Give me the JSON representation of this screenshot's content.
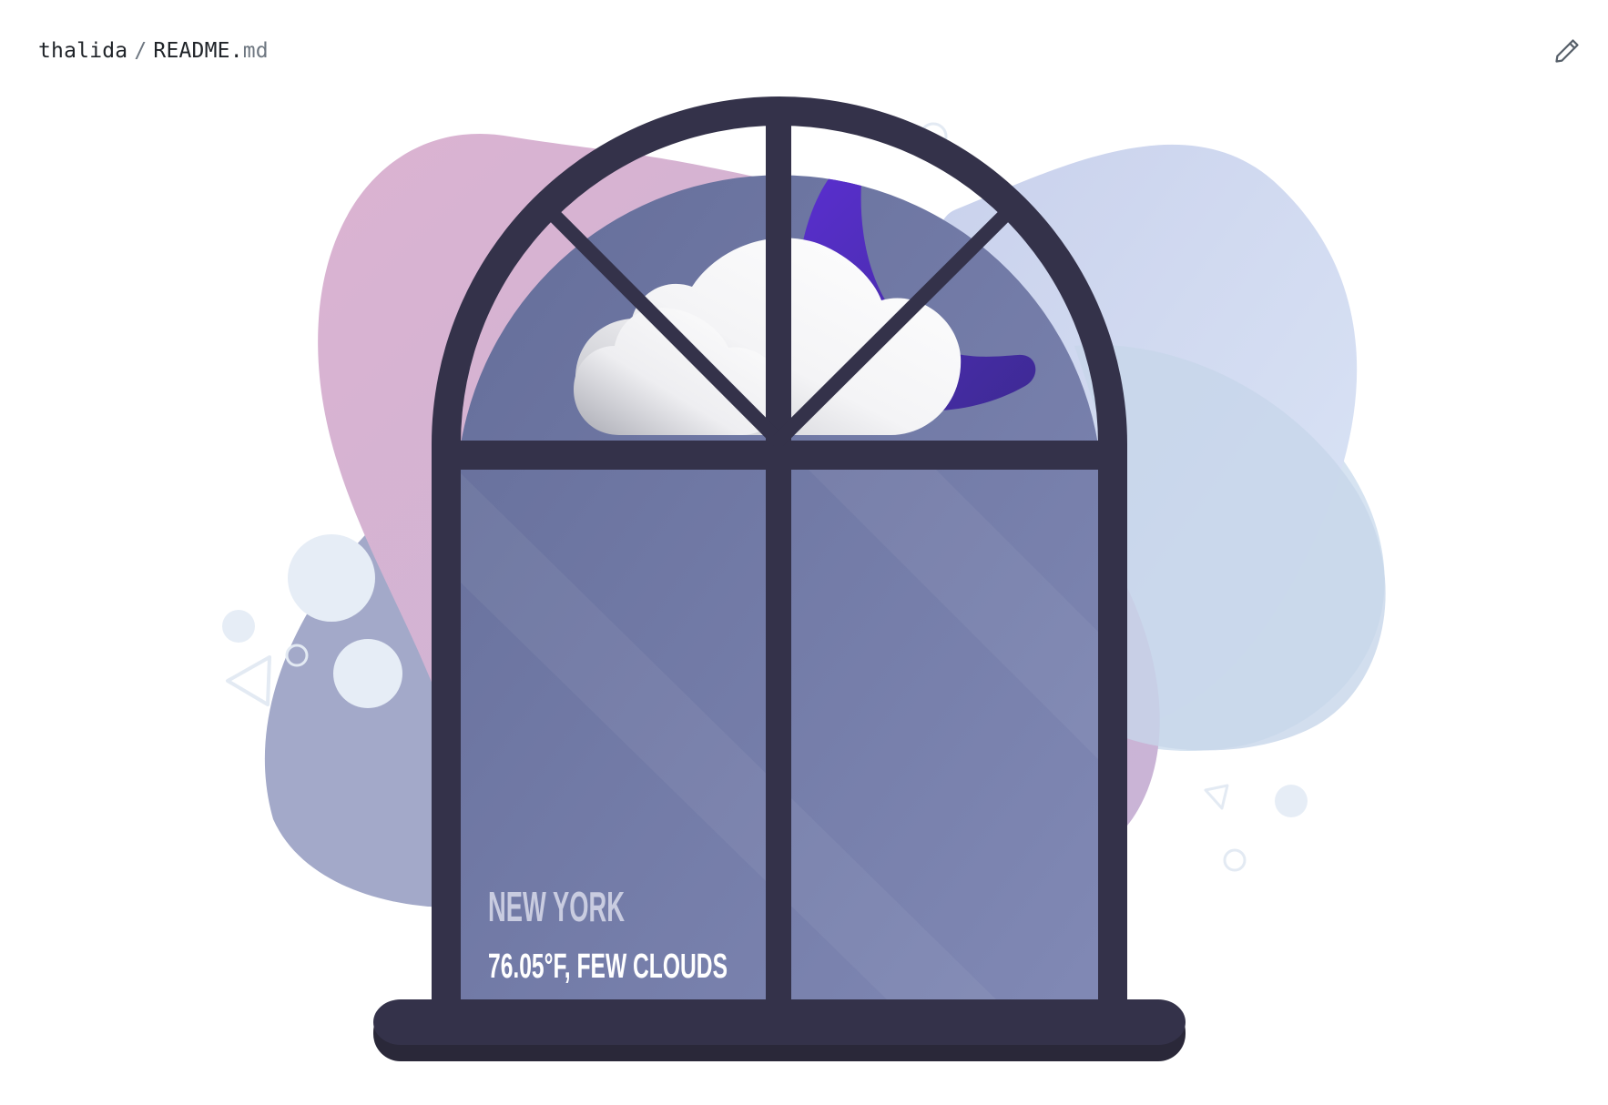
{
  "header": {
    "owner": "thalida",
    "separator": "/",
    "filename": "README.",
    "extension": "md"
  },
  "weather": {
    "city": "NEW YORK",
    "conditions": "76.05°F, FEW CLOUDS"
  },
  "icons": {
    "edit": "pencil-icon",
    "cloud": "cloud-icon",
    "moon": "crescent-moon-icon"
  },
  "colors": {
    "frame": "#34324a",
    "glass": "#6c76a0",
    "moon": "#4d2bb8",
    "text_city": "#c9cce0",
    "text_conditions": "#ffffff",
    "blob_pink": "#d6b6d3",
    "blob_blue": "#ccd6ee"
  }
}
